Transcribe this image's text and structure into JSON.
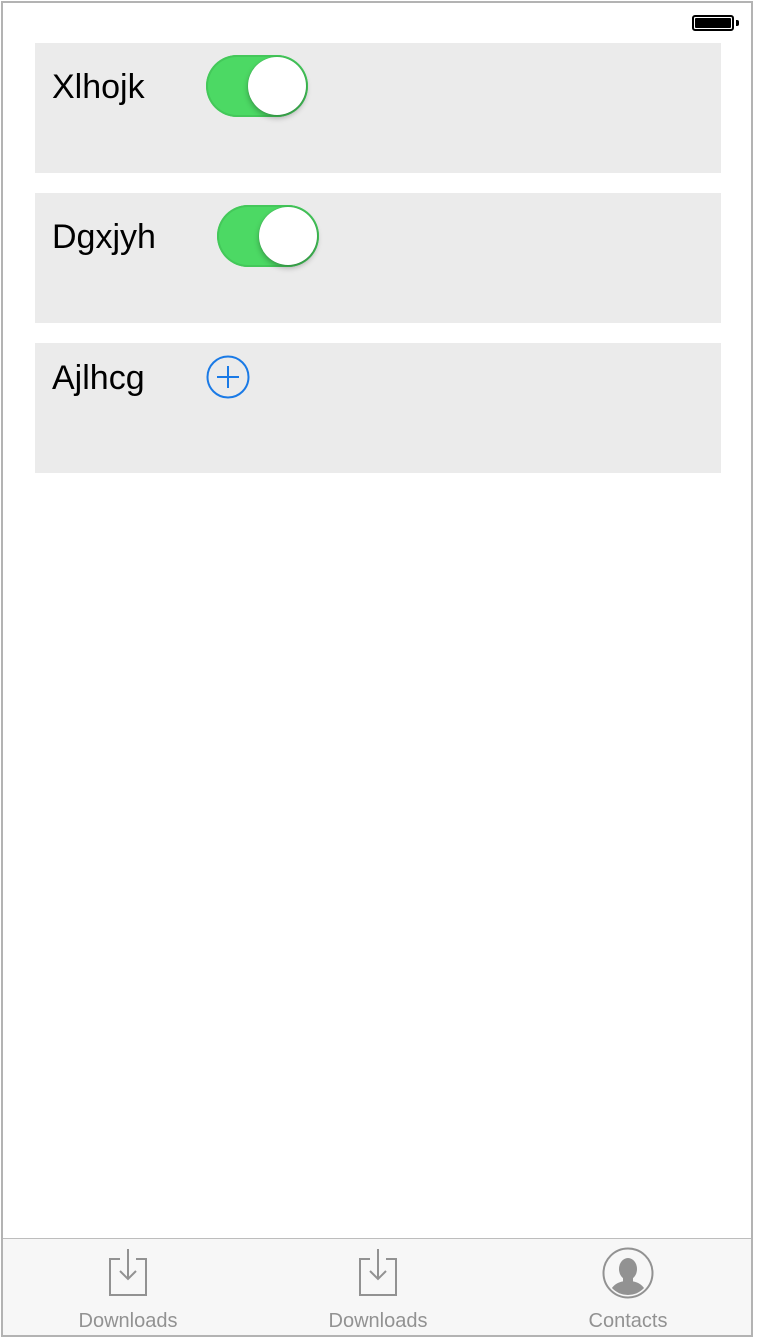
{
  "status_bar": {
    "battery_icon": "battery-full-icon"
  },
  "rows": [
    {
      "label": "Xlhojk",
      "control": "toggle",
      "on": true
    },
    {
      "label": "Dgxjyh",
      "control": "toggle",
      "on": true
    },
    {
      "label": "Ajlhcg",
      "control": "add-button",
      "icon": "add-circle-icon"
    }
  ],
  "tab_bar": {
    "tabs": [
      {
        "label": "Downloads",
        "icon": "download-icon"
      },
      {
        "label": "Downloads",
        "icon": "download-icon"
      },
      {
        "label": "Contacts",
        "icon": "contact-avatar-icon"
      }
    ]
  },
  "colors": {
    "toggle_on": "#4cd964",
    "accent_blue": "#1a7ae6",
    "card_background": "#ebebeb",
    "tab_label": "#929292"
  }
}
